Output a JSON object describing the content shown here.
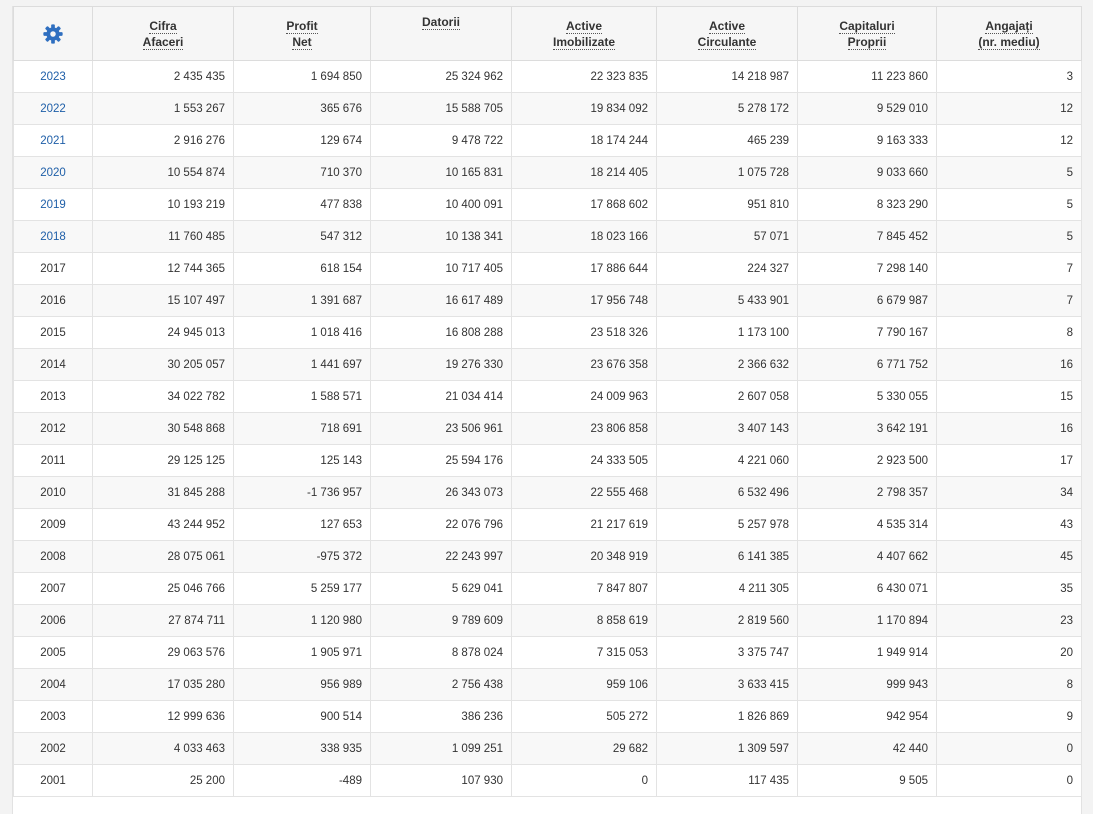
{
  "colors": {
    "link": "#1f5fa8",
    "gear": "#2f6fc0"
  },
  "header": {
    "settings_icon": "gear-icon",
    "columns": [
      {
        "line1": "Cifra",
        "line2": "Afaceri"
      },
      {
        "line1": "Profit",
        "line2": "Net"
      },
      {
        "line1": "Datorii",
        "line2": ""
      },
      {
        "line1": "Active",
        "line2": "Imobilizate"
      },
      {
        "line1": "Active",
        "line2": "Circulante"
      },
      {
        "line1": "Capitaluri",
        "line2": "Proprii"
      },
      {
        "line1": "Angajați",
        "line2": "(nr. mediu)"
      }
    ]
  },
  "rows": [
    {
      "year": "2023",
      "link": true,
      "values": [
        "2 435 435",
        "1 694 850",
        "25 324 962",
        "22 323 835",
        "14 218 987",
        "11 223 860",
        "3"
      ]
    },
    {
      "year": "2022",
      "link": true,
      "values": [
        "1 553 267",
        "365 676",
        "15 588 705",
        "19 834 092",
        "5 278 172",
        "9 529 010",
        "12"
      ]
    },
    {
      "year": "2021",
      "link": true,
      "values": [
        "2 916 276",
        "129 674",
        "9 478 722",
        "18 174 244",
        "465 239",
        "9 163 333",
        "12"
      ]
    },
    {
      "year": "2020",
      "link": true,
      "values": [
        "10 554 874",
        "710 370",
        "10 165 831",
        "18 214 405",
        "1 075 728",
        "9 033 660",
        "5"
      ]
    },
    {
      "year": "2019",
      "link": true,
      "values": [
        "10 193 219",
        "477 838",
        "10 400 091",
        "17 868 602",
        "951 810",
        "8 323 290",
        "5"
      ]
    },
    {
      "year": "2018",
      "link": true,
      "values": [
        "11 760 485",
        "547 312",
        "10 138 341",
        "18 023 166",
        "57 071",
        "7 845 452",
        "5"
      ]
    },
    {
      "year": "2017",
      "link": false,
      "values": [
        "12 744 365",
        "618 154",
        "10 717 405",
        "17 886 644",
        "224 327",
        "7 298 140",
        "7"
      ]
    },
    {
      "year": "2016",
      "link": false,
      "values": [
        "15 107 497",
        "1 391 687",
        "16 617 489",
        "17 956 748",
        "5 433 901",
        "6 679 987",
        "7"
      ]
    },
    {
      "year": "2015",
      "link": false,
      "values": [
        "24 945 013",
        "1 018 416",
        "16 808 288",
        "23 518 326",
        "1 173 100",
        "7 790 167",
        "8"
      ]
    },
    {
      "year": "2014",
      "link": false,
      "values": [
        "30 205 057",
        "1 441 697",
        "19 276 330",
        "23 676 358",
        "2 366 632",
        "6 771 752",
        "16"
      ]
    },
    {
      "year": "2013",
      "link": false,
      "values": [
        "34 022 782",
        "1 588 571",
        "21 034 414",
        "24 009 963",
        "2 607 058",
        "5 330 055",
        "15"
      ]
    },
    {
      "year": "2012",
      "link": false,
      "values": [
        "30 548 868",
        "718 691",
        "23 506 961",
        "23 806 858",
        "3 407 143",
        "3 642 191",
        "16"
      ]
    },
    {
      "year": "2011",
      "link": false,
      "values": [
        "29 125 125",
        "125 143",
        "25 594 176",
        "24 333 505",
        "4 221 060",
        "2 923 500",
        "17"
      ]
    },
    {
      "year": "2010",
      "link": false,
      "values": [
        "31 845 288",
        "-1 736 957",
        "26 343 073",
        "22 555 468",
        "6 532 496",
        "2 798 357",
        "34"
      ]
    },
    {
      "year": "2009",
      "link": false,
      "values": [
        "43 244 952",
        "127 653",
        "22 076 796",
        "21 217 619",
        "5 257 978",
        "4 535 314",
        "43"
      ]
    },
    {
      "year": "2008",
      "link": false,
      "values": [
        "28 075 061",
        "-975 372",
        "22 243 997",
        "20 348 919",
        "6 141 385",
        "4 407 662",
        "45"
      ]
    },
    {
      "year": "2007",
      "link": false,
      "values": [
        "25 046 766",
        "5 259 177",
        "5 629 041",
        "7 847 807",
        "4 211 305",
        "6 430 071",
        "35"
      ]
    },
    {
      "year": "2006",
      "link": false,
      "values": [
        "27 874 711",
        "1 120 980",
        "9 789 609",
        "8 858 619",
        "2 819 560",
        "1 170 894",
        "23"
      ]
    },
    {
      "year": "2005",
      "link": false,
      "values": [
        "29 063 576",
        "1 905 971",
        "8 878 024",
        "7 315 053",
        "3 375 747",
        "1 949 914",
        "20"
      ]
    },
    {
      "year": "2004",
      "link": false,
      "values": [
        "17 035 280",
        "956 989",
        "2 756 438",
        "959 106",
        "3 633 415",
        "999 943",
        "8"
      ]
    },
    {
      "year": "2003",
      "link": false,
      "values": [
        "12 999 636",
        "900 514",
        "386 236",
        "505 272",
        "1 826 869",
        "942 954",
        "9"
      ]
    },
    {
      "year": "2002",
      "link": false,
      "values": [
        "4 033 463",
        "338 935",
        "1 099 251",
        "29 682",
        "1 309 597",
        "42 440",
        "0"
      ]
    },
    {
      "year": "2001",
      "link": false,
      "values": [
        "25 200",
        "-489",
        "107 930",
        "0",
        "117 435",
        "9 505",
        "0"
      ]
    }
  ]
}
